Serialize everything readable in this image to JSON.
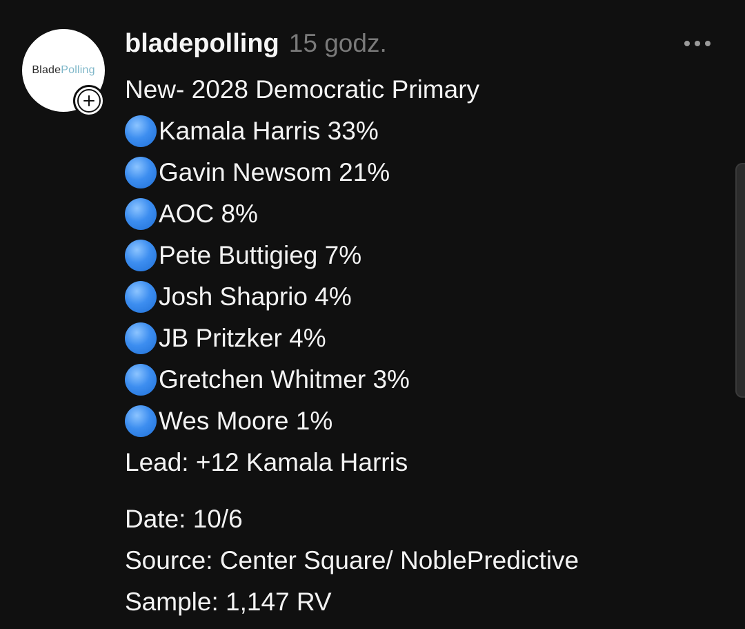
{
  "post": {
    "username": "bladepolling",
    "timestamp": "15 godz.",
    "avatar_text_a": "Blade",
    "avatar_text_b": "Polling",
    "title": "New- 2028 Democratic Primary",
    "candidates": [
      {
        "name": "Kamala Harris 33%"
      },
      {
        "name": "Gavin Newsom 21%"
      },
      {
        "name": "AOC 8%"
      },
      {
        "name": "Pete Buttigieg 7%"
      },
      {
        "name": "Josh Shaprio 4%"
      },
      {
        "name": "JB Pritzker 4%"
      },
      {
        "name": "Gretchen Whitmer 3%"
      },
      {
        "name": "Wes Moore 1%"
      }
    ],
    "lead": "Lead: +12 Kamala Harris",
    "date": "Date: 10/6",
    "source": "Source: Center Square/ NoblePredictive",
    "sample": "Sample: 1,147 RV"
  },
  "icons": {
    "bullet": "blue-circle-icon",
    "follow": "plus-circle-icon",
    "more": "more-horizontal-icon"
  },
  "colors": {
    "background": "#101010",
    "text": "#f3f3f3",
    "muted": "#7a7a7a",
    "bullet_blue": "#3d8ef0",
    "logo_accent": "#7fb7c9"
  }
}
